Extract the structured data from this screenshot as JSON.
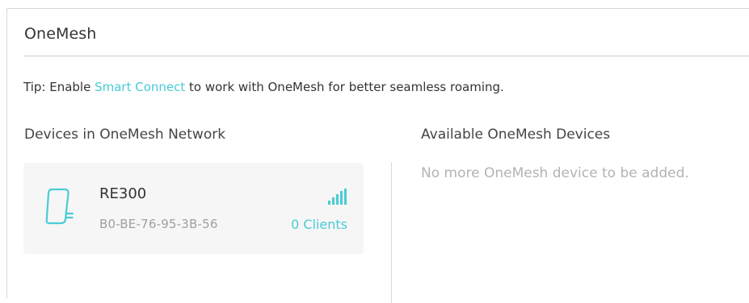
{
  "panel": {
    "title": "OneMesh"
  },
  "tip": {
    "prefix": "Tip:  Enable ",
    "link_label": "Smart Connect",
    "suffix": " to work with OneMesh for better seamless roaming."
  },
  "devices_section": {
    "heading": "Devices in OneMesh Network",
    "devices": [
      {
        "name": "RE300",
        "mac": "B0-BE-76-95-3B-56",
        "clients_label": "0 Clients",
        "icon": "range-extender-icon",
        "signal_icon": "signal-strength-icon"
      }
    ]
  },
  "available_section": {
    "heading": "Available OneMesh Devices",
    "empty_message": "No more OneMesh device to be added."
  },
  "colors": {
    "accent": "#4acbd6",
    "card_bg": "#f6f6f6",
    "muted_text": "#a0a0a0",
    "divider": "#cccccc"
  }
}
